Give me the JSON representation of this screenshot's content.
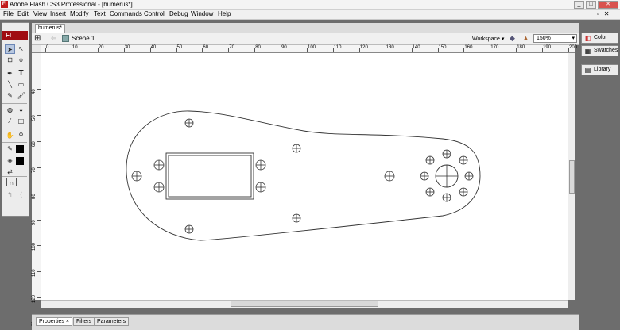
{
  "app": {
    "title": "Adobe Flash CS3 Professional - [humerus*]",
    "logo": "Fl",
    "win_min": "_",
    "win_max": "□",
    "win_close": "✕"
  },
  "menu": [
    "File",
    "Edit",
    "View",
    "Insert",
    "Modify",
    "Text",
    "Commands",
    "Control",
    "Debug",
    "Window",
    "Help"
  ],
  "menu_right": "_ ▫ ✕",
  "toolbox": {
    "badge": "Fl"
  },
  "document": {
    "tab": "humerus*",
    "scene": "Scene 1",
    "workspace": "Workspace ▾",
    "zoom": "150%"
  },
  "ruler": {
    "h": [
      "0",
      "10",
      "20",
      "30",
      "40",
      "50",
      "60",
      "70",
      "80",
      "90",
      "100",
      "110",
      "120",
      "130",
      "140",
      "150",
      "160",
      "170",
      "180",
      "190",
      "200"
    ],
    "v": [
      "40",
      "50",
      "60",
      "70",
      "80",
      "90",
      "100",
      "110",
      "120",
      "130"
    ]
  },
  "properties": {
    "tabs": [
      "Properties ×",
      "Filters",
      "Parameters"
    ]
  },
  "panels": [
    {
      "label": "Color",
      "icon": "color-icon"
    },
    {
      "label": "Swatches",
      "icon": "swatches-icon"
    },
    {
      "label": "Library",
      "icon": "library-icon"
    }
  ]
}
